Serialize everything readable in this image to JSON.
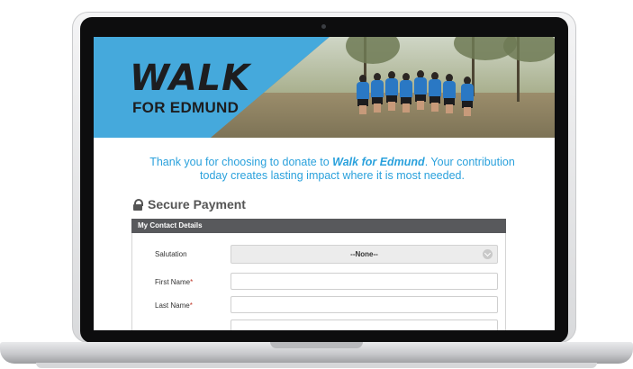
{
  "banner": {
    "logo_main": "WALK",
    "logo_sub": "FOR EDMUND"
  },
  "intro": {
    "text_before": "Thank you for choosing to donate to ",
    "highlight": "Walk for Edmund",
    "text_after": ". Your contribution  today creates lasting impact where it is most needed."
  },
  "payment": {
    "title": "Secure Payment",
    "section_title": "My Contact Details"
  },
  "form": {
    "salutation_label": "Salutation",
    "salutation_value": "--None--",
    "first_name_label": "First Name",
    "last_name_label": "Last Name",
    "required_mark": "*"
  },
  "colors": {
    "accent": "#2aa1dc",
    "banner": "#45a9dc",
    "section_bar": "#58595c"
  }
}
